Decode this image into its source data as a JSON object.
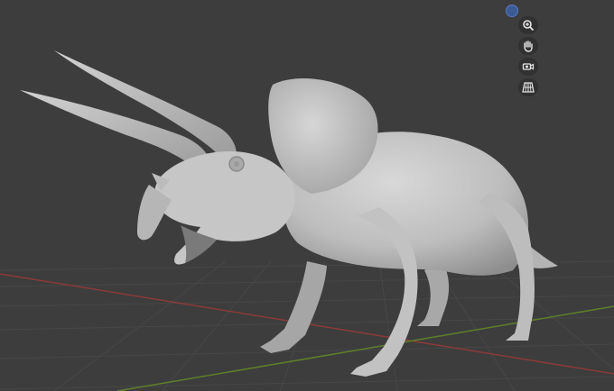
{
  "viewport": {
    "mode": "3d-viewport",
    "background_color": "#3d3d3d",
    "grid_color": "#4a4a4a",
    "x_axis_color": "#8a3a3a",
    "y_axis_color": "#5f7f2a",
    "model_color": "#c4c4c4"
  },
  "navigation": {
    "gizmo": {
      "icon": "axis-gizmo-icon",
      "color": "#3c5a96"
    },
    "tools": [
      {
        "name": "zoom",
        "icon": "zoom-icon"
      },
      {
        "name": "pan",
        "icon": "hand-icon"
      },
      {
        "name": "camera",
        "icon": "camera-icon"
      },
      {
        "name": "perspective",
        "icon": "grid-perspective-icon"
      }
    ]
  }
}
